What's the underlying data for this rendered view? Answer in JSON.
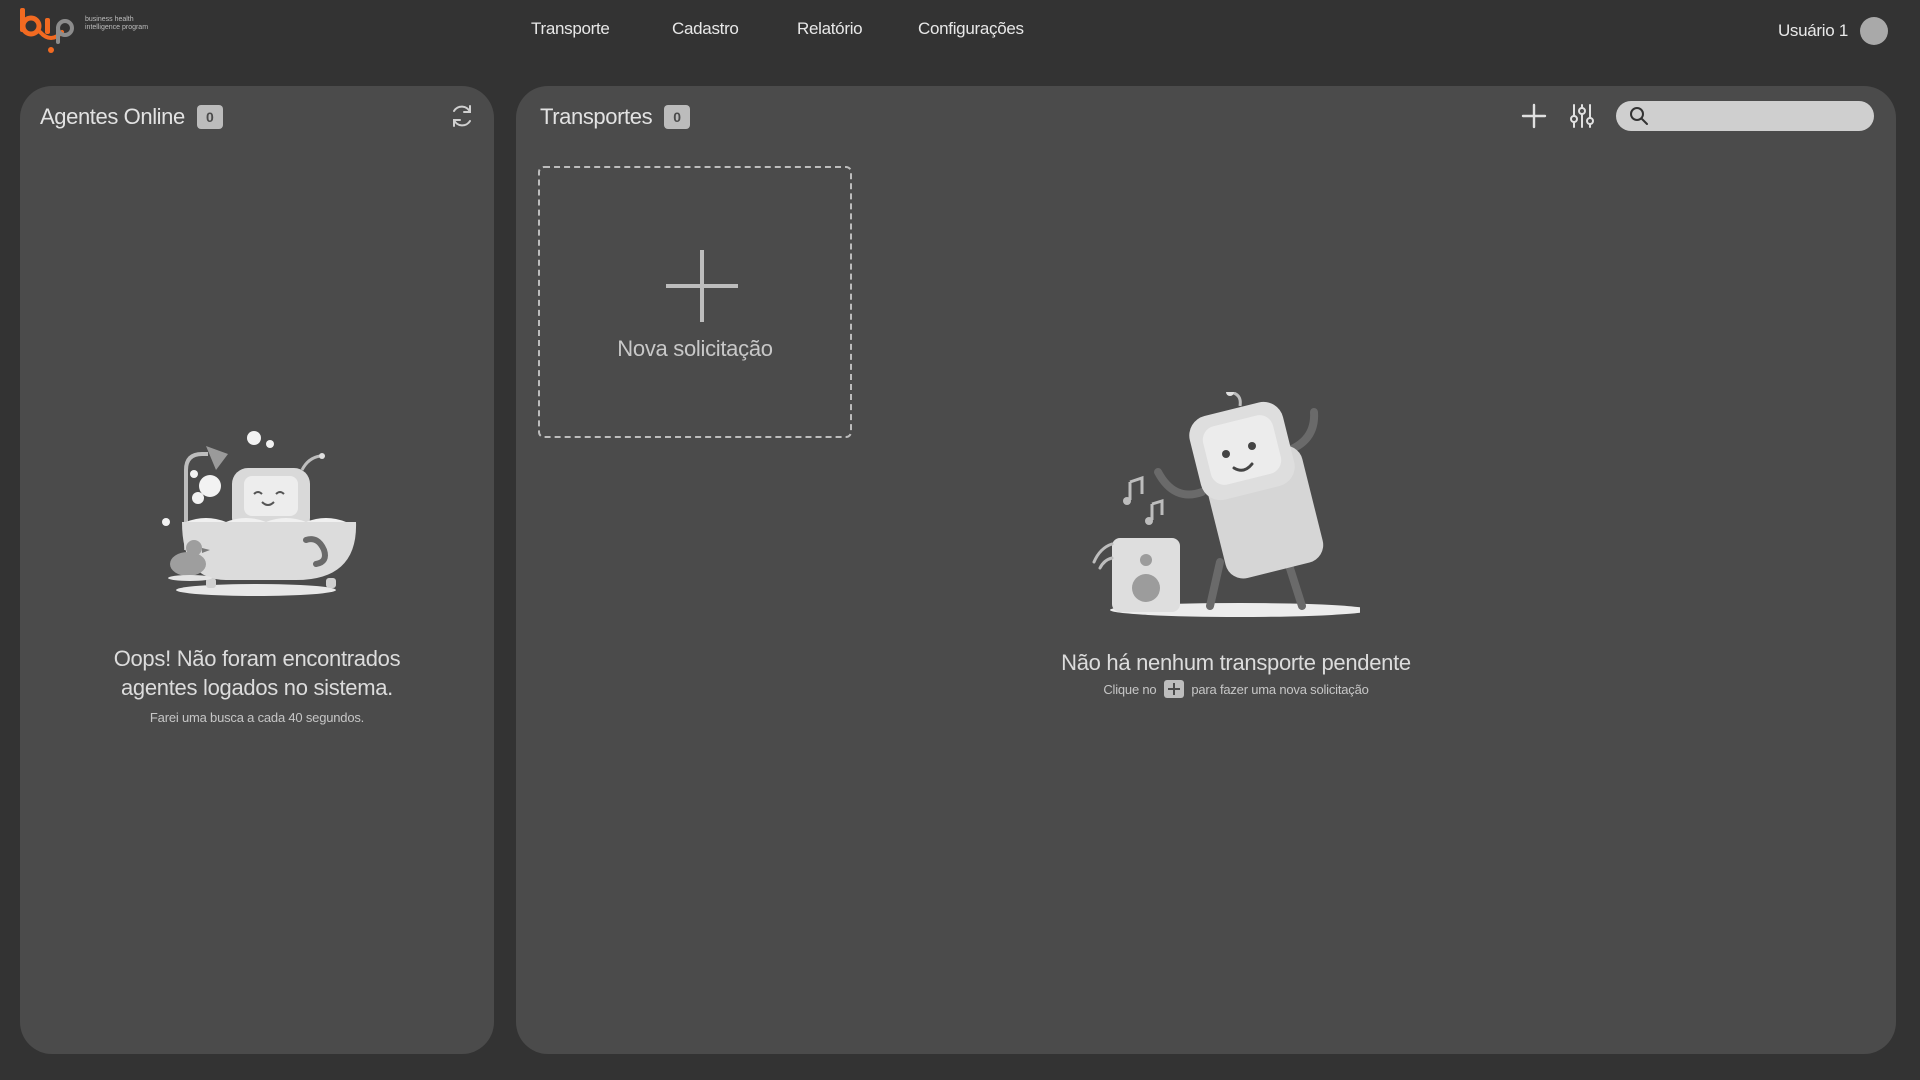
{
  "brand": {
    "logo_text": "bip",
    "tagline": "business health intelligence program",
    "accent_color": "#f26a21"
  },
  "nav": {
    "items": [
      {
        "label": "Transporte"
      },
      {
        "label": "Cadastro"
      },
      {
        "label": "Relatório"
      },
      {
        "label": "Configurações"
      }
    ]
  },
  "user": {
    "name": "Usuário 1"
  },
  "agents_panel": {
    "title": "Agentes Online",
    "count": "0",
    "refresh_icon": "refresh-icon",
    "empty_title_line1": "Oops! Não foram encontrados",
    "empty_title_line2": "agentes logados no sistema.",
    "empty_subtitle": "Farei uma busca a cada 40 segundos."
  },
  "transports_panel": {
    "title": "Transportes",
    "count": "0",
    "add_icon": "plus-icon",
    "filter_icon": "sliders-icon",
    "search_icon": "search-icon",
    "search_value": "",
    "new_request_label": "Nova solicitação",
    "empty_title": "Não há nenhum transporte pendente",
    "empty_hint_before": "Clique no",
    "empty_hint_after": "para fazer uma nova solicitação"
  }
}
